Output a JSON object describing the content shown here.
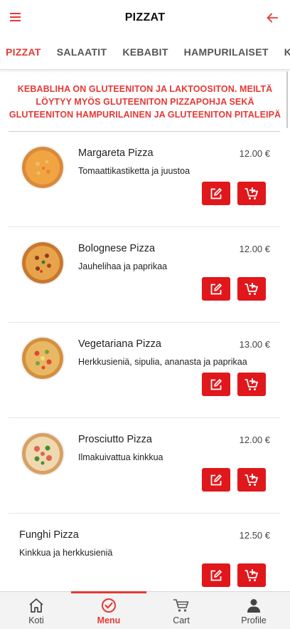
{
  "header": {
    "title": "PIZZAT",
    "menu_icon": "hamburger-icon",
    "back_icon": "arrow-left-icon"
  },
  "tabs": [
    {
      "label": "PIZZAT",
      "active": true
    },
    {
      "label": "SALAATIT"
    },
    {
      "label": "KEBABIT"
    },
    {
      "label": "HAMPURILAISET"
    },
    {
      "label": "KANA"
    }
  ],
  "notice": "KEBABLIHA ON GLUTEENITON JA LAKTOOSITON. MEILTÄ LÖYTYY MYÖS GLUTEENITON PIZZAPOHJA SEKÄ GLUTEENITON HAMPURILAINEN JA GLUTEENITON PITALEIPÄ",
  "products": [
    {
      "name": "Margareta Pizza",
      "description": "Tomaattikastiketta ja juustoa",
      "price": "12.00 €"
    },
    {
      "name": "Bolognese Pizza",
      "description": "Jauhelihaa ja paprikaa",
      "price": "12.00 €"
    },
    {
      "name": "Vegetariana Pizza",
      "description": "Herkkusieniä, sipulia, ananasta ja paprikaa",
      "price": "13.00 €"
    },
    {
      "name": "Prosciutto Pizza",
      "description": "Ilmakuivattua kinkkua",
      "price": "12.00 €"
    },
    {
      "name": "Funghi Pizza",
      "description": "Kinkkua ja herkkusieniä",
      "price": "12.50 €"
    }
  ],
  "bottom_nav": [
    {
      "label": "Koti",
      "icon": "home-icon"
    },
    {
      "label": "Menu",
      "icon": "check-circle-icon",
      "active": true
    },
    {
      "label": "Cart",
      "icon": "cart-icon"
    },
    {
      "label": "Profile",
      "icon": "person-icon"
    }
  ],
  "colors": {
    "accent": "#e53935",
    "button": "#e0171b"
  }
}
